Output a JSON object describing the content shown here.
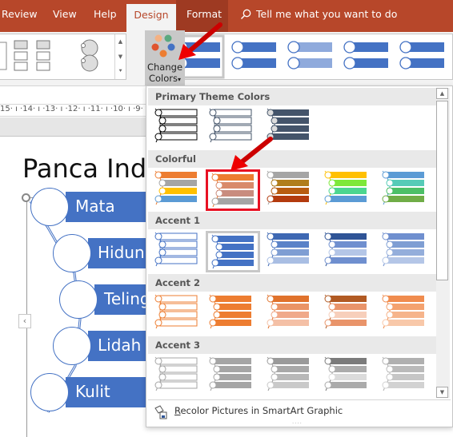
{
  "ribbon_tabs": {
    "review": "Review",
    "view": "View",
    "help": "Help",
    "design": "Design",
    "format": "Format"
  },
  "tell_me": {
    "placeholder": "Tell me what you want to do",
    "icon": "search-icon"
  },
  "change_colors": {
    "line1": "Change",
    "line2": "Colors",
    "dropdown_glyph": "▾",
    "dot_colors": [
      "#f4b183",
      "#5aa97f",
      "#e0542e",
      "#4472c4",
      "#ed7d31"
    ]
  },
  "ruler": {
    "ticks": "15· ı ·14· ı ·13· ı ·12· ı ·11· ı ·10· ı ·9· ı ·"
  },
  "slide": {
    "title": "Panca Ind",
    "items": [
      "Mata",
      "Hidun",
      "Teling",
      "Lidah",
      "Kulit"
    ]
  },
  "dropdown": {
    "sections": [
      {
        "title": "Primary Theme Colors",
        "swatches": [
          {
            "name": "dark-1-outline",
            "style": "outline",
            "colors": [
              "#000000",
              "#000000",
              "#000000",
              "#000000"
            ]
          },
          {
            "name": "dark-2-outline",
            "style": "outline",
            "colors": [
              "#44546a",
              "#44546a",
              "#44546a",
              "#44546a"
            ]
          },
          {
            "name": "dark-2-fill",
            "style": "fill",
            "colors": [
              "#44546a",
              "#44546a",
              "#44546a",
              "#44546a"
            ]
          }
        ]
      },
      {
        "title": "Colorful",
        "swatches": [
          {
            "name": "colorful-accent-colors",
            "style": "fill",
            "colors": [
              "#ed7d31",
              "#a5a5a5",
              "#ffc000",
              "#5b9bd5"
            ]
          },
          {
            "name": "colorful-range-accent-2-to-3",
            "style": "fill",
            "colors": [
              "#ed7d31",
              "#d98a6a",
              "#c98c7e",
              "#a5a5a5"
            ],
            "highlighted": true
          },
          {
            "name": "colorful-range-accent-3-to-4",
            "style": "fill",
            "colors": [
              "#a5a5a5",
              "#b07d1c",
              "#b85c10",
              "#b33b0e"
            ]
          },
          {
            "name": "colorful-range-accent-4-to-5",
            "style": "fill",
            "colors": [
              "#ffc000",
              "#7ee83a",
              "#4cd68f",
              "#5b9bd5"
            ]
          },
          {
            "name": "colorful-range-accent-5-to-6",
            "style": "fill",
            "colors": [
              "#5b9bd5",
              "#56cbb7",
              "#4cbf67",
              "#70ad47"
            ]
          }
        ]
      },
      {
        "title": "Accent 1",
        "swatches": [
          {
            "name": "accent1-outline",
            "style": "outline",
            "colors": [
              "#4472c4",
              "#4472c4",
              "#4472c4",
              "#4472c4"
            ]
          },
          {
            "name": "accent1-colored-fill",
            "style": "fill",
            "colors": [
              "#4472c4",
              "#4472c4",
              "#4472c4",
              "#4472c4"
            ],
            "selected": true
          },
          {
            "name": "accent1-gradient-range",
            "style": "fill",
            "colors": [
              "#3e68b3",
              "#5a82c8",
              "#7f9ed3",
              "#a9bee3"
            ]
          },
          {
            "name": "accent1-gradient-loop",
            "style": "fill",
            "colors": [
              "#2f5496",
              "#6f8fcf",
              "#b4c6e7",
              "#6f8fcf"
            ]
          },
          {
            "name": "accent1-transparent-gradient",
            "style": "fill",
            "colors": [
              "#6f8fcf",
              "#7f9ed3",
              "#94aedb",
              "#b4c6e7"
            ]
          }
        ]
      },
      {
        "title": "Accent 2",
        "swatches": [
          {
            "name": "accent2-outline",
            "style": "outline",
            "colors": [
              "#ed7d31",
              "#ed7d31",
              "#ed7d31",
              "#ed7d31"
            ]
          },
          {
            "name": "accent2-colored-fill",
            "style": "fill",
            "colors": [
              "#ed7d31",
              "#ed7d31",
              "#ed7d31",
              "#ed7d31"
            ]
          },
          {
            "name": "accent2-gradient-range",
            "style": "fill",
            "colors": [
              "#e0722c",
              "#ea9466",
              "#f0a98a",
              "#f4c0a6"
            ]
          },
          {
            "name": "accent2-gradient-loop",
            "style": "fill",
            "colors": [
              "#b15a23",
              "#e9946a",
              "#f7cfbb",
              "#e9946a"
            ]
          },
          {
            "name": "accent2-transparent-gradient",
            "style": "fill",
            "colors": [
              "#f08c4e",
              "#f4a26f",
              "#f6b48b",
              "#f8c8a9"
            ]
          }
        ]
      },
      {
        "title": "Accent 3",
        "swatches": [
          {
            "name": "accent3-outline",
            "style": "outline",
            "colors": [
              "#a5a5a5",
              "#a5a5a5",
              "#a5a5a5",
              "#a5a5a5"
            ]
          },
          {
            "name": "accent3-colored-fill",
            "style": "fill",
            "colors": [
              "#a5a5a5",
              "#a5a5a5",
              "#a5a5a5",
              "#a5a5a5"
            ]
          },
          {
            "name": "accent3-gradient-range",
            "style": "fill",
            "colors": [
              "#9a9a9a",
              "#a8a8a8",
              "#b8b8b8",
              "#c9c9c9"
            ]
          },
          {
            "name": "accent3-gradient-loop",
            "style": "fill",
            "colors": [
              "#7b7b7b",
              "#ababab",
              "#dbdbdb",
              "#ababab"
            ]
          },
          {
            "name": "accent3-transparent-gradient",
            "style": "fill",
            "colors": [
              "#b0b0b0",
              "#bababa",
              "#c6c6c6",
              "#d2d2d2"
            ]
          }
        ]
      }
    ],
    "recolor_label": "Recolor Pictures in SmartArt Graphic",
    "recolor_mnemonic": "R",
    "grip": "....",
    "scroll_up": "▲",
    "scroll_down": "▼"
  },
  "layout_gallery_scroll": {
    "up": "▲",
    "down": "▼",
    "more": "⯆"
  },
  "collapse_button": "‹",
  "colors": {
    "title_bar": "#b7472a",
    "accent_blue": "#4472c4",
    "highlight_red": "#e81123"
  }
}
